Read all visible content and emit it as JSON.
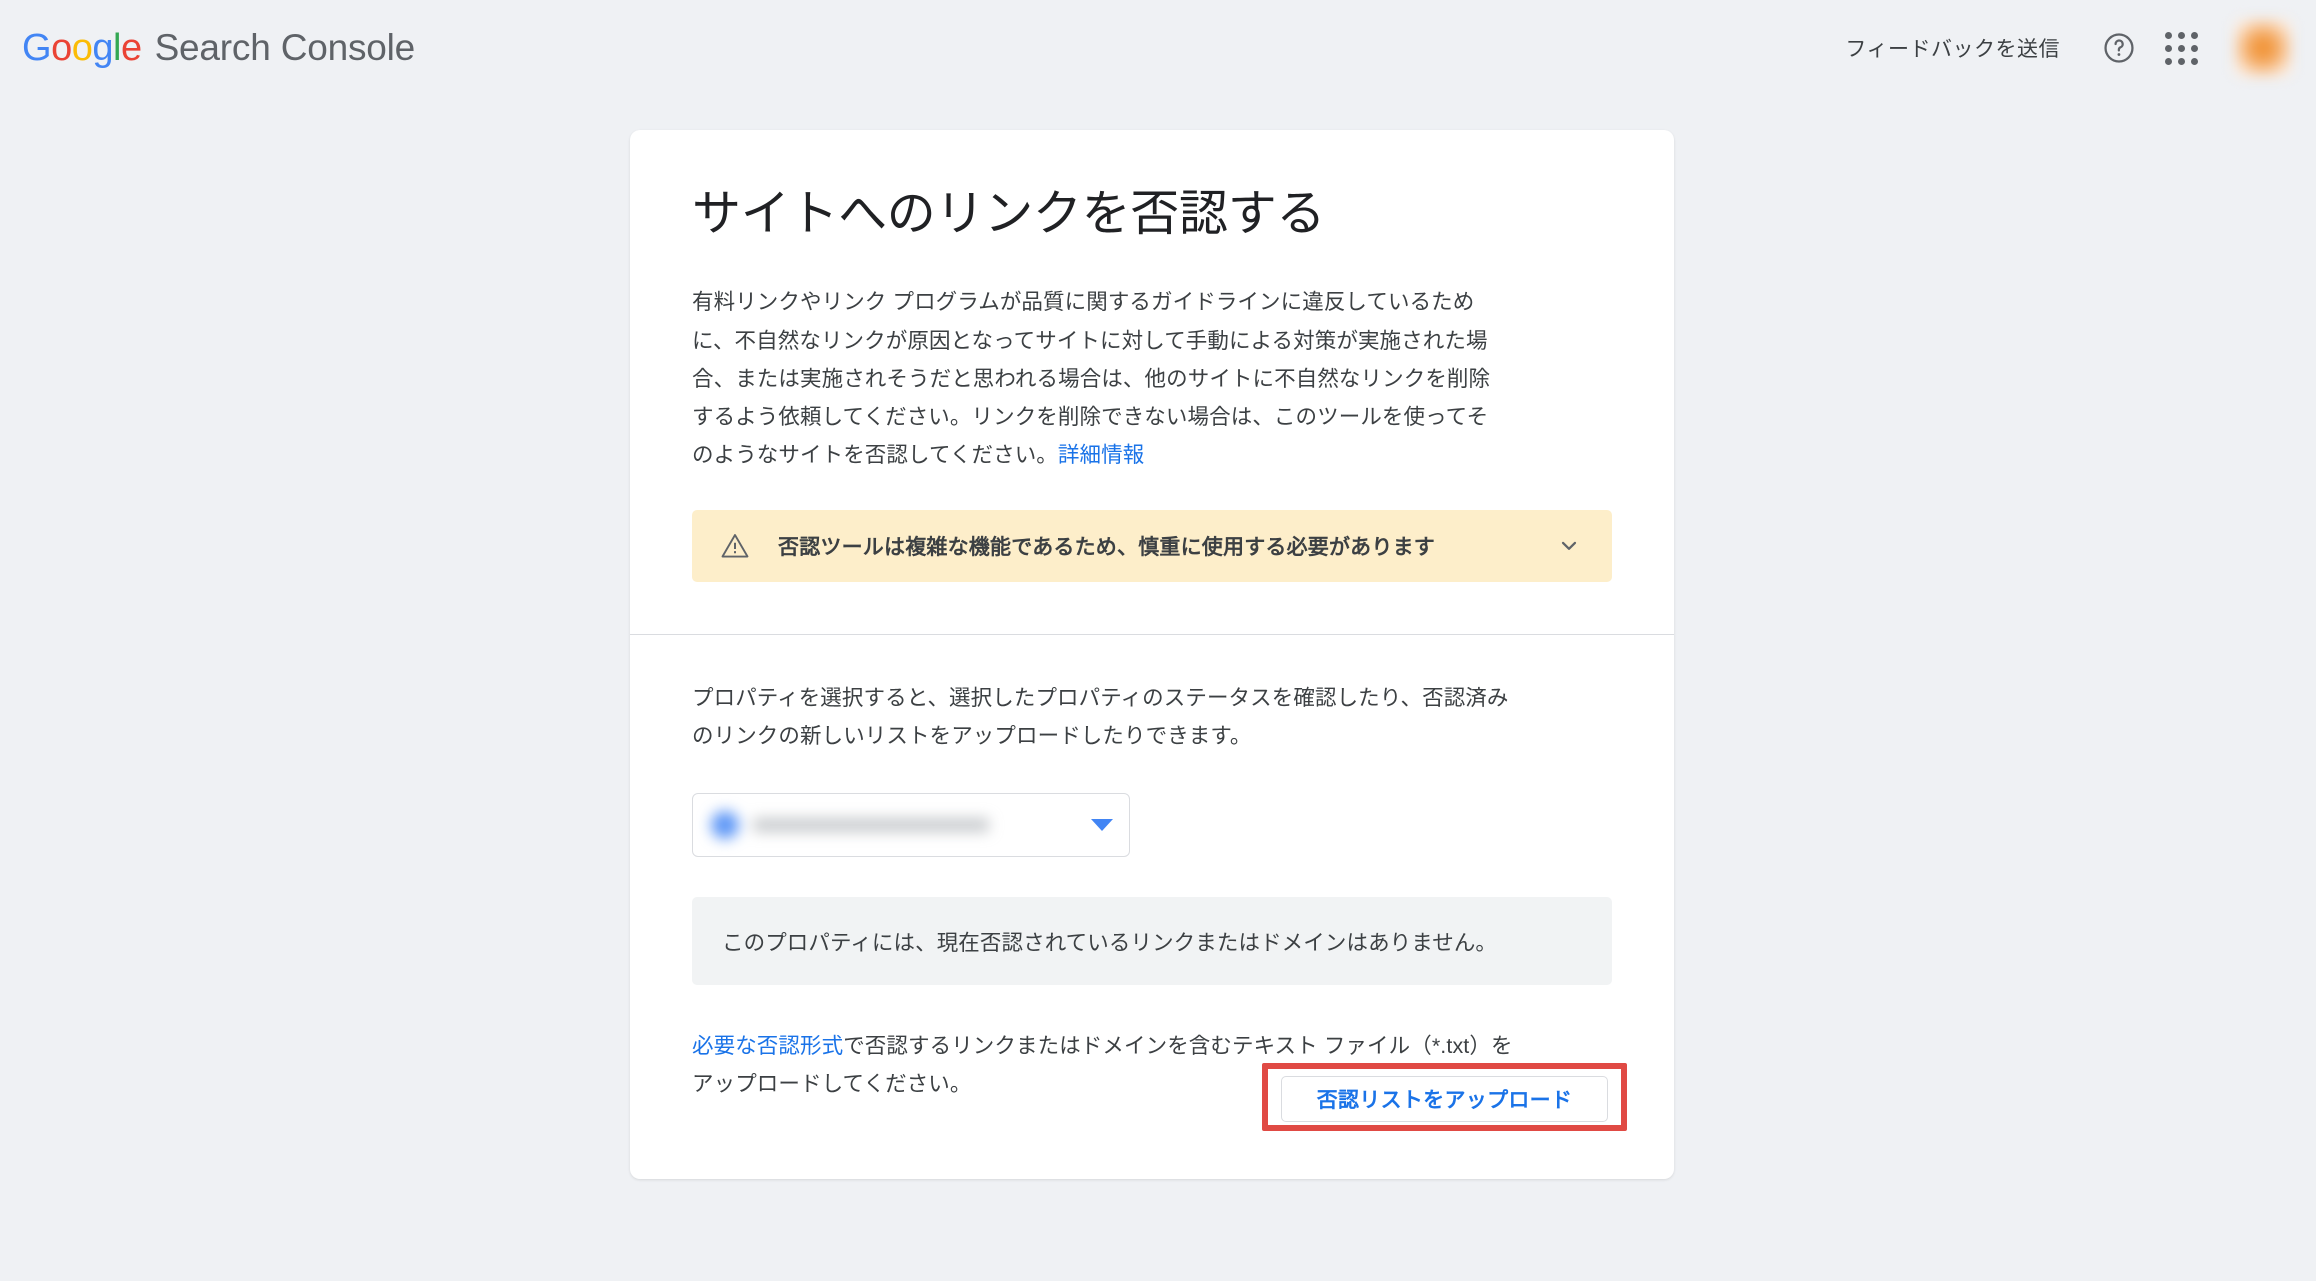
{
  "header": {
    "brand_google": "Google",
    "brand_g": "G",
    "brand_o1": "o",
    "brand_o2": "o",
    "brand_g2": "g",
    "brand_l": "l",
    "brand_e": "e",
    "product": "Search Console",
    "feedback_label": "フィードバックを送信",
    "help_icon": "help-circle-icon",
    "apps_icon": "apps-grid-icon",
    "avatar_icon": "user-avatar"
  },
  "main": {
    "title": "サイトへのリンクを否認する",
    "intro": "有料リンクやリンク プログラムが品質に関するガイドラインに違反しているために、不自然なリンクが原因となってサイトに対して手動による対策が実施された場合、または実施されそうだと思われる場合は、他のサイトに不自然なリンクを削除するよう依頼してください。リンクを削除できない場合は、このツールを使ってそのようなサイトを否認してください。",
    "intro_link": "詳細情報",
    "warning": {
      "icon": "warning-triangle-icon",
      "text": "否認ツールは複雑な機能であるため、慎重に使用する必要があります",
      "expand_icon": "chevron-down-icon"
    },
    "section_description": "プロパティを選択すると、選択したプロパティのステータスを確認したり、否認済みのリンクの新しいリストをアップロードしたりできます。",
    "property_select": {
      "value": "",
      "redacted": true,
      "caret_icon": "dropdown-caret-icon"
    },
    "status_message": "このプロパティには、現在否認されているリンクまたはドメインはありません。",
    "upload_note_link": "必要な否認形式",
    "upload_note_rest": "で否認するリンクまたはドメインを含むテキスト ファイル（*.txt）をアップロードしてください。",
    "upload_button": "否認リストをアップロード"
  },
  "colors": {
    "page_background": "#eff1f4",
    "card_background": "#ffffff",
    "accent_blue": "#1a73e8",
    "warning_background": "#fdeeca",
    "status_background": "#f1f3f4",
    "annotation_red": "#e04a44",
    "text_primary": "#202124",
    "text_secondary": "#3c4043"
  }
}
